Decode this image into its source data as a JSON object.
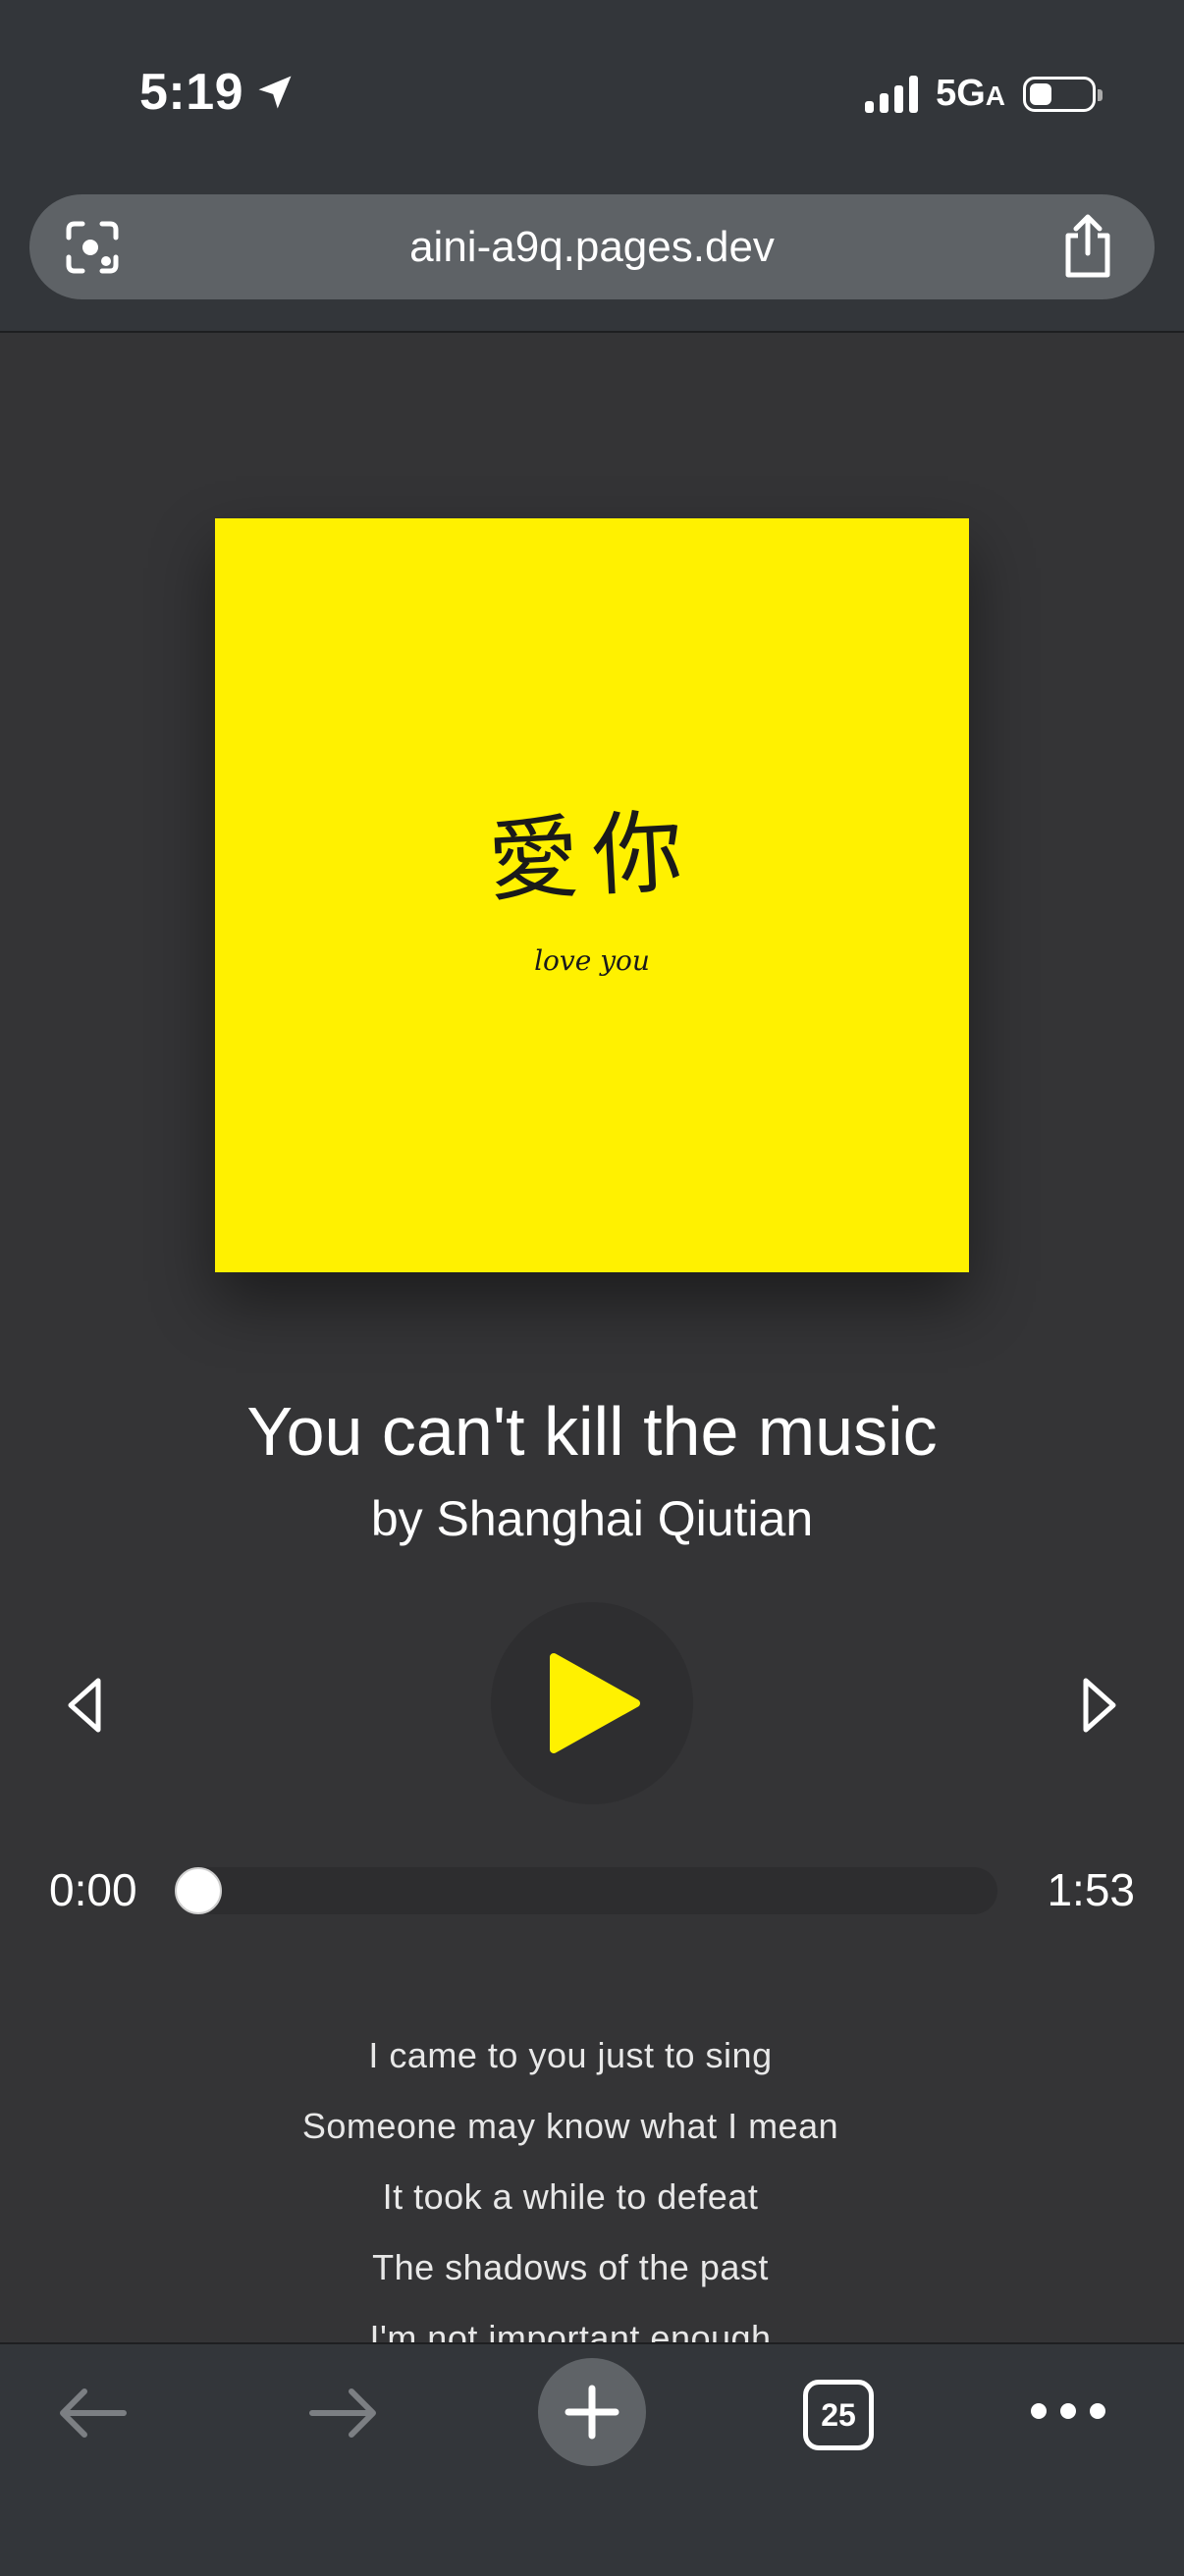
{
  "status_bar": {
    "time": "5:19",
    "network": "5G",
    "network_suffix": "A"
  },
  "browser": {
    "url": "aini-a9q.pages.dev",
    "tab_count": "25"
  },
  "album": {
    "title": "愛你",
    "subtitle": "love you",
    "background": "#fff100"
  },
  "track": {
    "title": "You can't kill the music",
    "artist": "by Shanghai Qiutian",
    "current_time": "0:00",
    "duration": "1:53",
    "progress": 0
  },
  "lyrics": [
    "I came to you just to sing",
    "Someone may know what I mean",
    "It took a while to defeat",
    "The shadows of the past",
    "I'm not important enough"
  ],
  "icons": {
    "location": "location-arrow-icon",
    "lens": "lens-camera-icon",
    "share": "share-icon",
    "prev": "previous-icon",
    "play": "play-icon",
    "next": "next-icon",
    "back": "back-arrow-icon",
    "forward": "forward-arrow-icon",
    "new_tab": "plus-icon",
    "menu": "more-icon"
  },
  "colors": {
    "accent": "#fff100",
    "background": "#343436",
    "chrome": "#33363a"
  }
}
